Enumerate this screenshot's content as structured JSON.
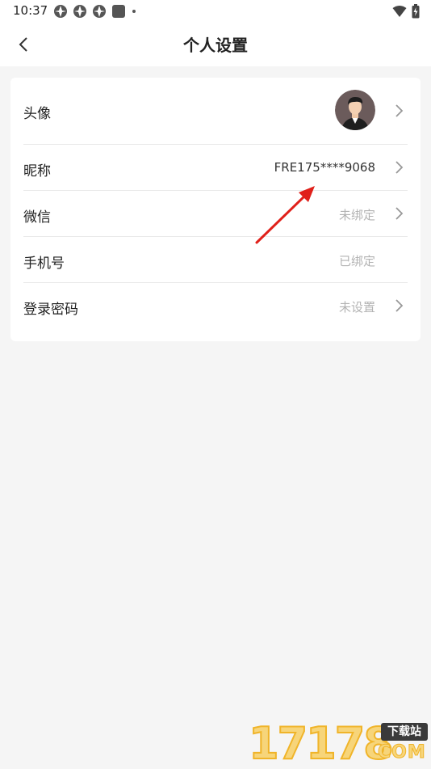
{
  "status_bar": {
    "time": "10:37"
  },
  "header": {
    "title": "个人设置"
  },
  "settings": {
    "rows": [
      {
        "label": "头像",
        "value": "",
        "has_chevron": true
      },
      {
        "label": "昵称",
        "value": "FRE175****9068",
        "has_chevron": true
      },
      {
        "label": "微信",
        "value": "未绑定",
        "has_chevron": true
      },
      {
        "label": "手机号",
        "value": "已绑定",
        "has_chevron": false
      },
      {
        "label": "登录密码",
        "value": "未设置",
        "has_chevron": true
      }
    ]
  },
  "watermark": {
    "digits": "17178",
    "tag": "下载站",
    "suffix": "COM"
  },
  "colors": {
    "background": "#f5f5f5",
    "card": "#ffffff",
    "muted_text": "#b3b3b3",
    "annotation_arrow": "#e0201a"
  }
}
